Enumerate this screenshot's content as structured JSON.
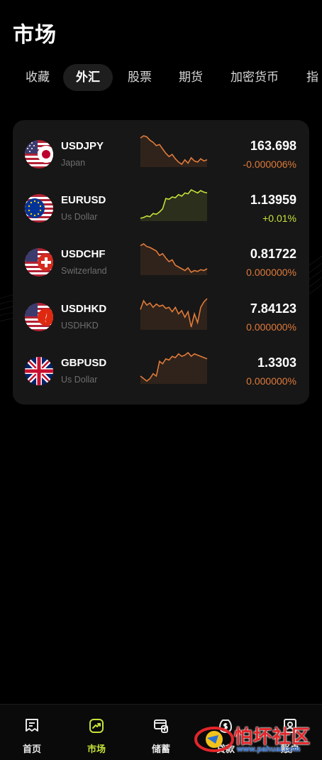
{
  "header": {
    "title": "市场"
  },
  "tabs": [
    {
      "label": "收藏",
      "active": false
    },
    {
      "label": "外汇",
      "active": true
    },
    {
      "label": "股票",
      "active": false
    },
    {
      "label": "期货",
      "active": false
    },
    {
      "label": "加密货币",
      "active": false
    },
    {
      "label": "指",
      "active": false
    }
  ],
  "colors": {
    "accent": "#c4e23a",
    "down": "#e07a3a",
    "up": "#c4e23a",
    "card": "#171717"
  },
  "quotes": [
    {
      "symbol": "USDJPY",
      "name": "Japan",
      "price": "163.698",
      "change": "-0.000006%",
      "direction": "down",
      "flag": "us-jp-flag-icon",
      "spark": [
        62,
        64,
        63,
        60,
        58,
        55,
        56,
        52,
        48,
        45,
        47,
        43,
        40,
        38,
        42,
        39,
        44,
        41,
        40,
        43,
        41,
        42
      ]
    },
    {
      "symbol": "EURUSD",
      "name": "Us Dollar",
      "price": "1.13959",
      "change": "+0.01%",
      "direction": "up",
      "flag": "eu-us-flag-icon",
      "spark": [
        30,
        31,
        33,
        32,
        36,
        35,
        38,
        42,
        55,
        54,
        57,
        56,
        60,
        58,
        62,
        61,
        66,
        64,
        62,
        65,
        63,
        62
      ]
    },
    {
      "symbol": "USDCHF",
      "name": "Switzerland",
      "price": "0.81722",
      "change": "0.000000%",
      "direction": "down",
      "flag": "us-ch-flag-icon",
      "spark": [
        66,
        68,
        65,
        64,
        62,
        60,
        55,
        57,
        52,
        48,
        50,
        44,
        42,
        40,
        38,
        41,
        36,
        38,
        37,
        39,
        38,
        40
      ]
    },
    {
      "symbol": "USDHKD",
      "name": "USDHKD",
      "price": "7.84123",
      "change": "0.000000%",
      "direction": "down",
      "flag": "us-hk-flag-icon",
      "spark": [
        48,
        56,
        52,
        54,
        50,
        53,
        51,
        52,
        49,
        50,
        46,
        50,
        44,
        47,
        41,
        46,
        32,
        44,
        36,
        50,
        55,
        58
      ]
    },
    {
      "symbol": "GBPUSD",
      "name": "Us Dollar",
      "price": "1.3303",
      "change": "0.000000%",
      "direction": "down",
      "flag": "uk-us-flag-icon",
      "spark": [
        40,
        38,
        36,
        38,
        42,
        40,
        52,
        50,
        54,
        53,
        56,
        55,
        58,
        56,
        57,
        59,
        56,
        58,
        57,
        56,
        55,
        54
      ]
    }
  ],
  "bottom_nav": [
    {
      "label": "首页",
      "icon": "home-doc-icon",
      "active": false
    },
    {
      "label": "市场",
      "icon": "market-trend-icon",
      "active": true
    },
    {
      "label": "储蓄",
      "icon": "savings-icon",
      "active": false
    },
    {
      "label": "贷款",
      "icon": "loan-icon",
      "active": false
    },
    {
      "label": "账户",
      "icon": "account-icon",
      "active": false
    }
  ],
  "watermark": {
    "text": "怕坏社区",
    "url": "www.pahuai.com"
  }
}
